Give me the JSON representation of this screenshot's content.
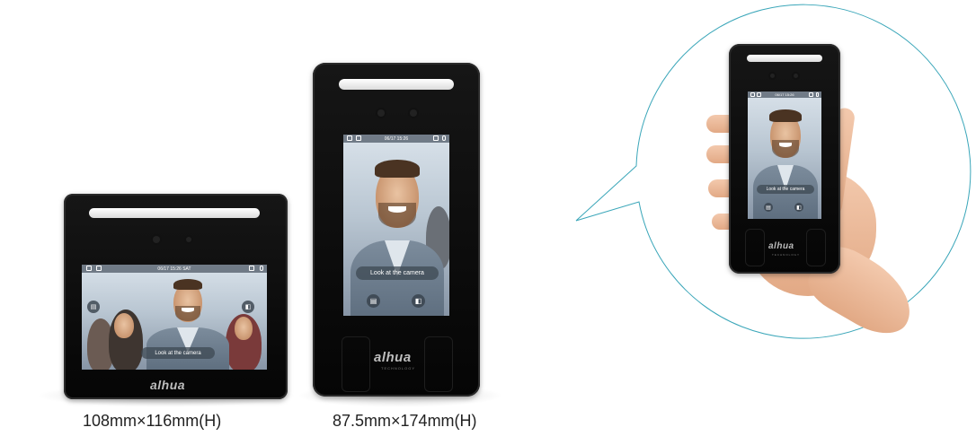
{
  "small_device": {
    "screen_datetime": "06/17 15:26  SAT",
    "prompt": "Look at the camera",
    "logo": "alhua",
    "caption": "108mm×116mm(H)"
  },
  "tall_device": {
    "screen_datetime": "06/17 15:26",
    "prompt": "Look at the camera",
    "logo": "alhua",
    "logo_sub": "TECHNOLOGY",
    "caption": "87.5mm×174mm(H)"
  },
  "handheld_device": {
    "screen_datetime": "06/17 15:26",
    "prompt": "Look at the camera",
    "logo": "alhua",
    "logo_sub": "TECHNOLOGY"
  },
  "colors": {
    "callout_stroke": "#3aa6b9",
    "device_body": "#0b0b0b"
  },
  "icons": [
    "card-icon",
    "door-icon",
    "face-icon",
    "wifi-icon"
  ]
}
